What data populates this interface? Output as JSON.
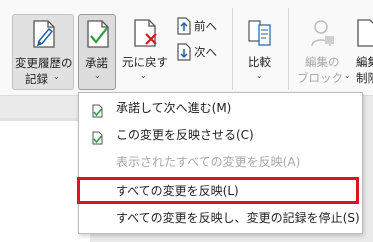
{
  "ribbon": {
    "track_changes": {
      "line1": "変更履歴の",
      "line2": "記録",
      "chev": "⌄"
    },
    "accept": {
      "label": "承諾",
      "chev": "⌄"
    },
    "reject": {
      "label": "元に戻す",
      "chev": "⌄"
    },
    "prev": {
      "label": "前へ"
    },
    "next": {
      "label": "次へ"
    },
    "compare": {
      "label": "比較",
      "chev": "⌄"
    },
    "block_authors": {
      "line1": "編集の",
      "line2": "ブロック",
      "chev": "⌄"
    },
    "restrict_editing": {
      "line1": "編集",
      "line2": "制限"
    }
  },
  "menu": {
    "items": [
      {
        "label": "承諾して次へ進む(M)"
      },
      {
        "label": "この変更を反映させる(C)"
      },
      {
        "label": "表示されたすべての変更を反映(A)"
      },
      {
        "label": "すべての変更を反映(L)"
      },
      {
        "label": "すべての変更を反映し、変更の記録を停止(S)"
      }
    ]
  },
  "colors": {
    "highlight": "#d9161f",
    "accept_icon": "#2e9e3f",
    "reject_icon": "#d9161f",
    "doc_icon_blue": "#1f5fa8"
  }
}
